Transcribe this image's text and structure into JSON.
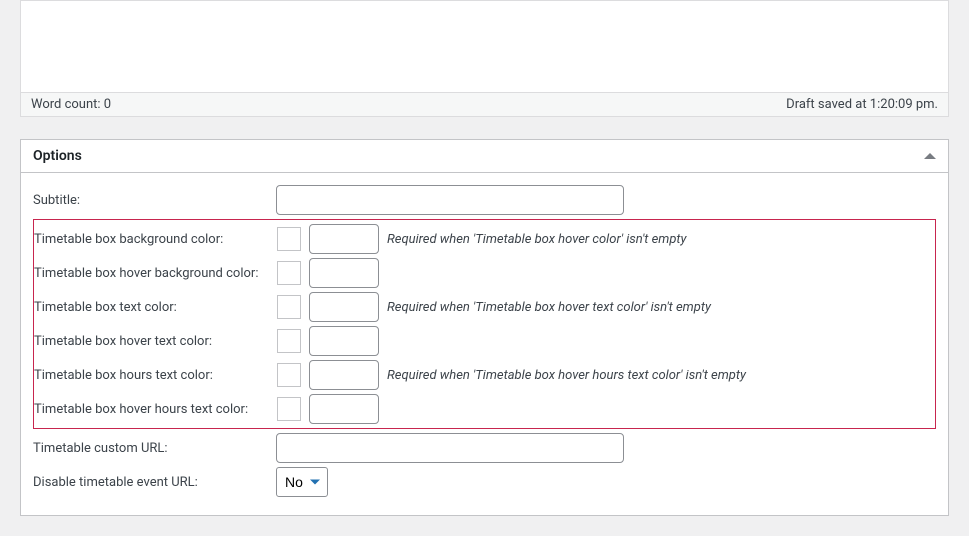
{
  "editor": {
    "word_count_label": "Word count: 0",
    "draft_saved_label": "Draft saved at 1:20:09 pm."
  },
  "panel": {
    "title": "Options",
    "fields": {
      "subtitle": {
        "label": "Subtitle:",
        "value": ""
      },
      "bg_color": {
        "label": "Timetable box background color:",
        "value": "",
        "hint": "Required when 'Timetable box hover color' isn't empty"
      },
      "hover_bg_color": {
        "label": "Timetable box hover background color:",
        "value": ""
      },
      "text_color": {
        "label": "Timetable box text color:",
        "value": "",
        "hint": "Required when 'Timetable box hover text color' isn't empty"
      },
      "hover_text_color": {
        "label": "Timetable box hover text color:",
        "value": ""
      },
      "hours_text_color": {
        "label": "Timetable box hours text color:",
        "value": "",
        "hint": "Required when 'Timetable box hover hours text color' isn't empty"
      },
      "hover_hours_text_color": {
        "label": "Timetable box hover hours text color:",
        "value": ""
      },
      "custom_url": {
        "label": "Timetable custom URL:",
        "value": ""
      },
      "disable_url": {
        "label": "Disable timetable event URL:",
        "selected": "No"
      }
    }
  }
}
